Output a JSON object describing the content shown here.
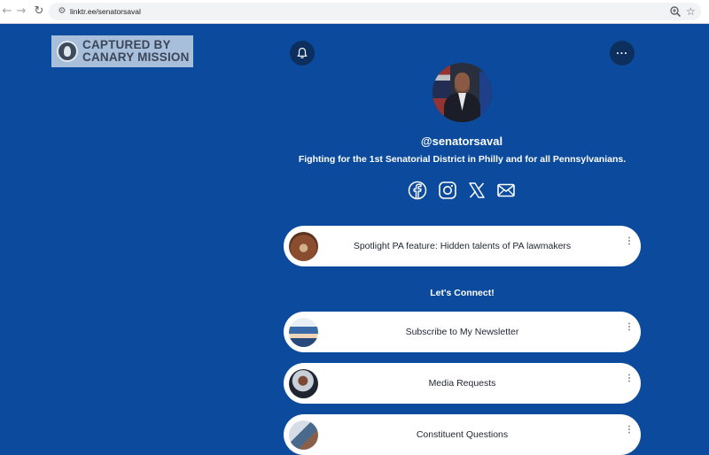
{
  "browser": {
    "url": "linktr.ee/senatorsaval"
  },
  "watermark": {
    "line1": "CAPTURED BY",
    "line2": "CANARY MISSION"
  },
  "colors": {
    "page_background": "#0b4a9c",
    "card_background": "#ffffff",
    "round_button": "#0d2f5e"
  },
  "header": {
    "bell_icon": "bell-icon",
    "more_label": "···"
  },
  "profile": {
    "handle": "@senatorsaval",
    "bio": "Fighting for the 1st Senatorial District in Philly and for all Pennsylvanians."
  },
  "socials": [
    "facebook-icon",
    "instagram-icon",
    "x-icon",
    "email-icon"
  ],
  "links": [
    {
      "label": "Spotlight PA feature: Hidden talents of PA lawmakers"
    }
  ],
  "section": {
    "title": "Let's Connect!"
  },
  "connect_links": [
    {
      "label": "Subscribe to My Newsletter"
    },
    {
      "label": "Media Requests"
    },
    {
      "label": "Constituent Questions"
    }
  ],
  "card_more_label": "⋮"
}
